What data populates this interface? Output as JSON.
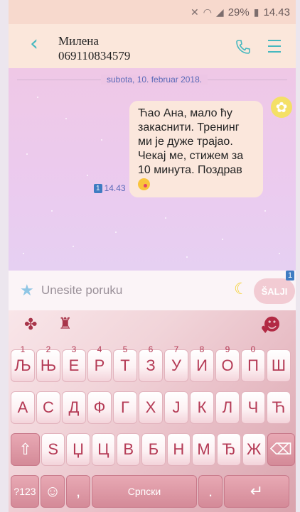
{
  "status": {
    "battery": "29%",
    "time": "14.43"
  },
  "header": {
    "contact_name": "Милена",
    "contact_number": "069110834579"
  },
  "chat": {
    "date": "subota, 10. februar 2018.",
    "message_text": "Ћао Ана, мало ћу закаснити. Тренинг ми је дуже трајао. Чекај ме, стижем за 10 минута. Поздрав",
    "sim": "1",
    "time": "14.43"
  },
  "input": {
    "placeholder": "Unesite poruku",
    "send_label": "ŠALJI",
    "send_sim": "1"
  },
  "keyboard": {
    "row1": [
      {
        "label": "Љ",
        "hint": "1"
      },
      {
        "label": "Њ",
        "hint": "2"
      },
      {
        "label": "Е",
        "hint": "3"
      },
      {
        "label": "Р",
        "hint": "4"
      },
      {
        "label": "Т",
        "hint": "5"
      },
      {
        "label": "З",
        "hint": "6"
      },
      {
        "label": "У",
        "hint": "7"
      },
      {
        "label": "И",
        "hint": "8"
      },
      {
        "label": "О",
        "hint": "9"
      },
      {
        "label": "П",
        "hint": "0"
      },
      {
        "label": "Ш",
        "hint": ""
      }
    ],
    "row2": [
      "А",
      "С",
      "Д",
      "Ф",
      "Г",
      "Х",
      "Ј",
      "К",
      "Л",
      "Ч",
      "Ћ"
    ],
    "row3": [
      "Ѕ",
      "Џ",
      "Ц",
      "В",
      "Б",
      "Н",
      "М",
      "Ђ",
      "Ж"
    ],
    "sym_label": "?123",
    "comma": ",",
    "space_label": "Српски",
    "period": "."
  },
  "icons": [
    "back-icon",
    "phone-icon",
    "menu-icon",
    "emoji-icon",
    "sticker-icon",
    "star-icon",
    "moon-icon",
    "clover-icon",
    "shirt-icon",
    "smile-icon",
    "shift-icon",
    "backspace-icon",
    "enter-icon"
  ]
}
